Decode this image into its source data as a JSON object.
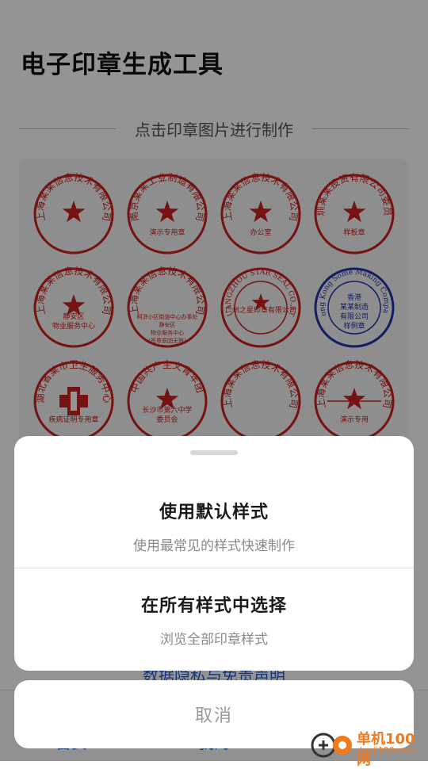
{
  "app": {
    "title": "电子印章生成工具",
    "subtitle": "点击印章图片进行制作",
    "privacy_link": "数据隐私与免责声明",
    "nav": [
      "首页",
      "我的"
    ]
  },
  "stamps": [
    {
      "type": "round-star",
      "top": "上海某某信息技术有限公司",
      "bottom": "",
      "color": "#cc1f1f"
    },
    {
      "type": "round-star",
      "top": "南京某某工业制造有限公司",
      "bottom": "演示专用章",
      "color": "#cc1f1f"
    },
    {
      "type": "round-star",
      "top": "上海某某信息技术有限公司",
      "bottom": "办公室",
      "color": "#cc1f1f"
    },
    {
      "type": "round-star",
      "top": "深圳某某投资有限公司委员会",
      "bottom": "样板章",
      "color": "#cc1f1f"
    },
    {
      "type": "round-star",
      "top": "上海某某信息技术有限公司",
      "bottom": "静安区 物业服务中心",
      "color": "#cc1f1f"
    },
    {
      "type": "round-text",
      "top": "上海某某信息技术有限公司",
      "bottom": "柯浒小区街道中心办事处 静安区 物业服务中心 (签章原因无效)",
      "color": "#cc1f1f"
    },
    {
      "type": "double-star",
      "top": "GUANGZHOU STAR SEAL CO.,LTD",
      "inner": "广州之星印章有限公司",
      "color": "#cc1f1f"
    },
    {
      "type": "hk",
      "top": "Hong Kong Some Making Company",
      "inner": "香港 某某制造 有限公司 样例章",
      "color": "#2233aa"
    },
    {
      "type": "medical",
      "top": "湖北省某市卫生服务中心",
      "bottom": "疾病证明专用章",
      "color": "#cc1f1f"
    },
    {
      "type": "round-star",
      "top": "中国共产主义青年团",
      "bottom": "长沙市第六中学 委员会",
      "color": "#cc1f1f"
    },
    {
      "type": "round-plain",
      "top": "上海某某信息技术有限公司",
      "bottom": "",
      "color": "#cc1f1f"
    },
    {
      "type": "round-line",
      "top": "上海某某信息技术有限公司",
      "bottom": "演示专用",
      "color": "#cc1f1f"
    }
  ],
  "sheet": {
    "option1_title": "使用默认样式",
    "option1_desc": "使用最常见的样式快速制作",
    "option2_title": "在所有样式中选择",
    "option2_desc": "浏览全部印章样式",
    "cancel": "取消"
  },
  "watermark": {
    "text1": "单机100网",
    "text2": "danji100.com",
    "accent": "#f07a1d"
  }
}
